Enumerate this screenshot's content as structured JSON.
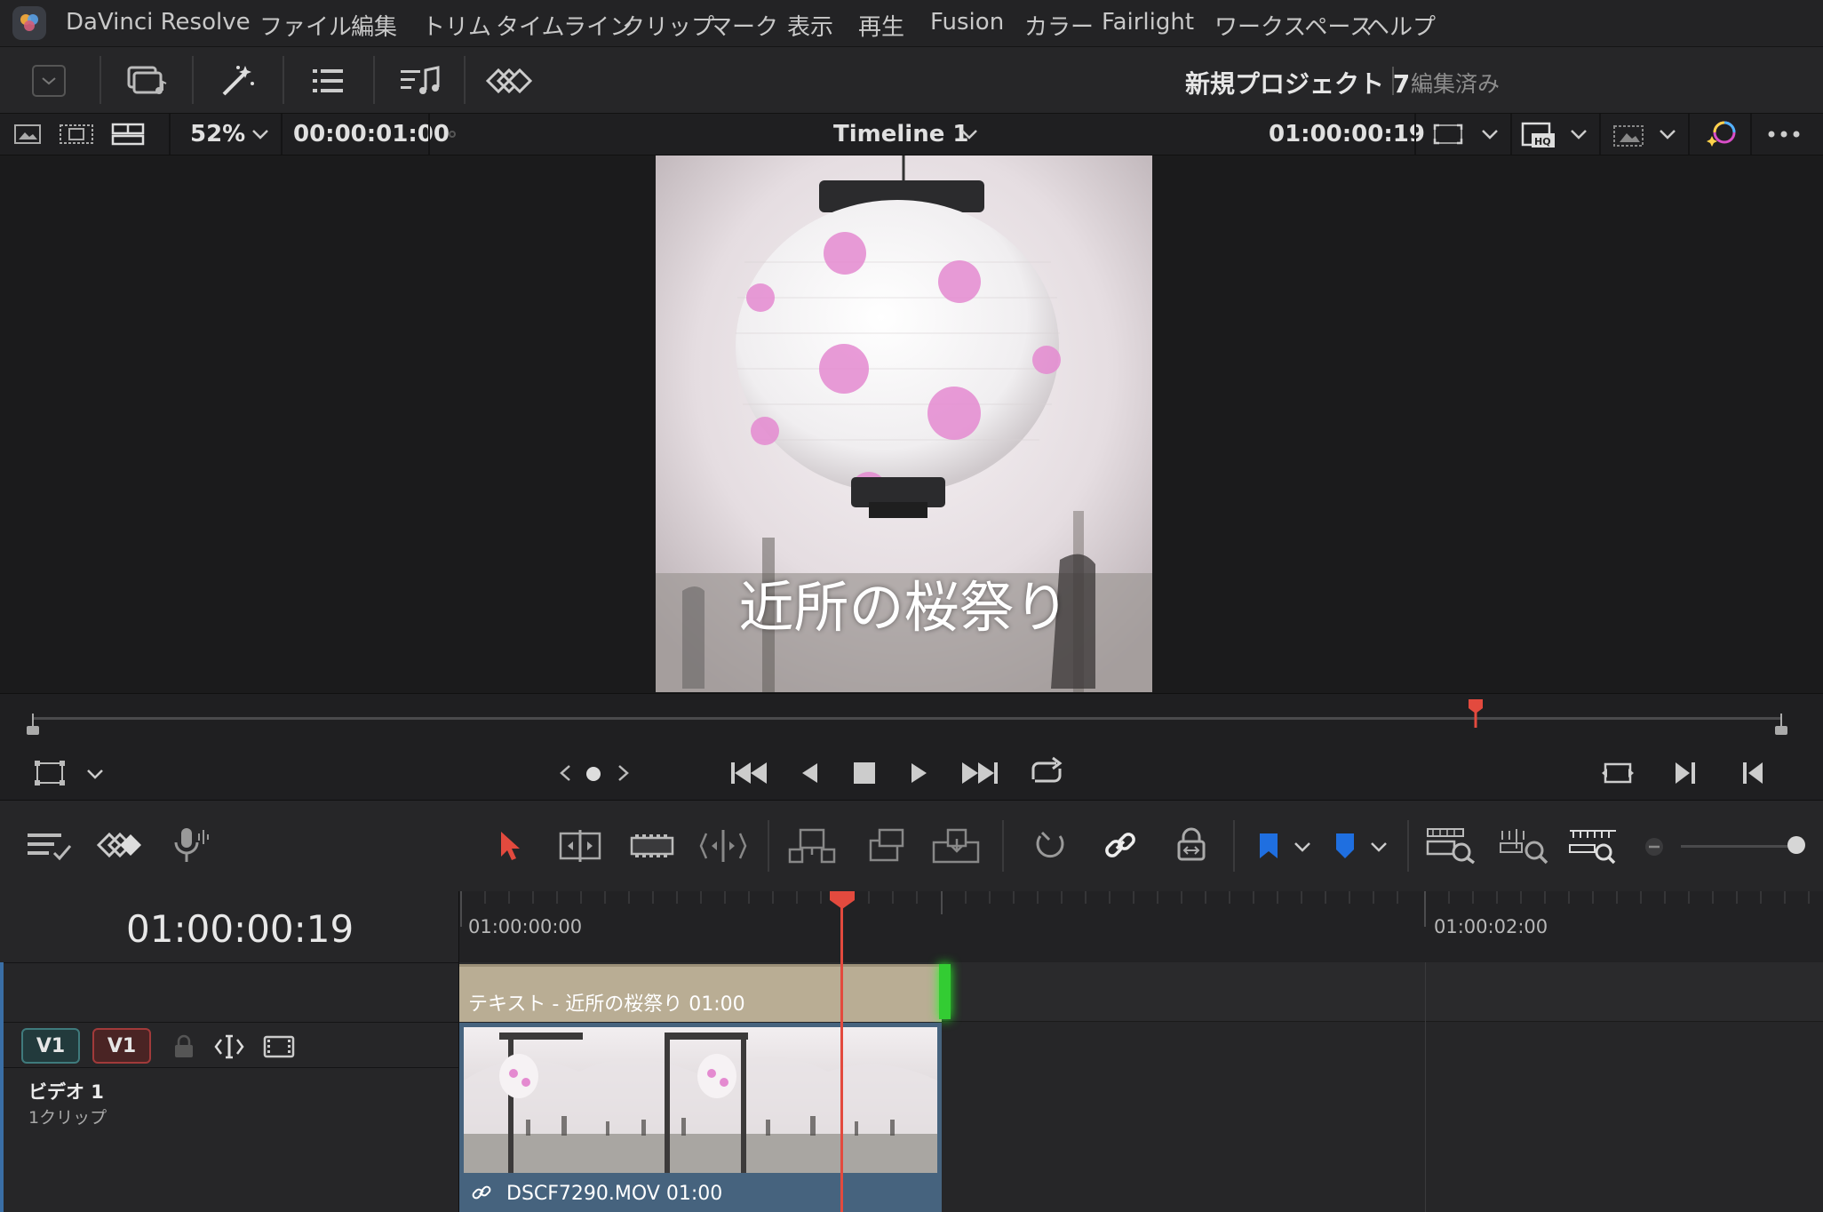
{
  "menubar": {
    "items": [
      "DaVinci Resolve",
      "ファイル",
      "編集",
      "トリム",
      "タイムライン",
      "クリップ",
      "マーク",
      "表示",
      "再生",
      "Fusion",
      "カラー",
      "Fairlight",
      "ワークスペース",
      "ヘルプ"
    ]
  },
  "toolbar": {
    "project_title": "新規プロジェクト 7",
    "project_status": "編集済み"
  },
  "viewer_header": {
    "zoom": "52%",
    "duration": "00:00:01:00",
    "timeline_name": "Timeline 1",
    "timecode": "01:00:00:19"
  },
  "viewer": {
    "title_overlay": "近所の桜祭り"
  },
  "timeline": {
    "current_timecode": "01:00:00:19",
    "ruler_labels": [
      "01:00:00:00",
      "01:00:02:00"
    ],
    "tracks": {
      "dest_label": "V1",
      "source_label": "V1",
      "name": "ビデオ 1",
      "clip_count": "1クリップ"
    },
    "text_clip_label": "テキスト - 近所の桜祭り  01:00",
    "video_clip_label": "DSCF7290.MOV  01:00"
  },
  "colors": {
    "accent_red": "#e34a3e",
    "text_clip": "#b9ad94",
    "video_clip": "#46637e",
    "clip_end_green": "#33cc33",
    "marker_blue": "#1f6fe0"
  }
}
